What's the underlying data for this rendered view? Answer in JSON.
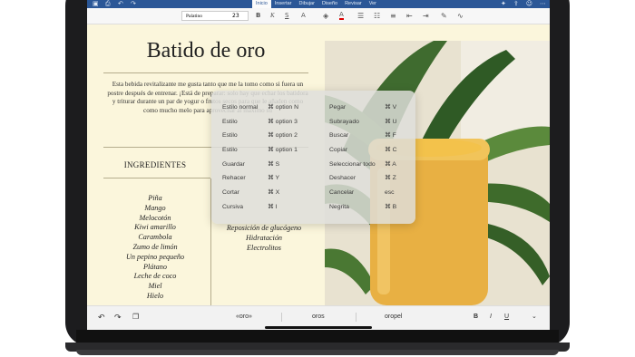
{
  "ribbon": {
    "tabs": [
      "Inicio",
      "Insertar",
      "Dibujar",
      "Diseño",
      "Revisar",
      "Ver"
    ],
    "active_tab": "Inicio",
    "colors": {
      "ribbon": "#2b5797",
      "page": "#fbf6dc"
    }
  },
  "toolbar": {
    "font_name": "Palatino",
    "font_size": "23"
  },
  "document": {
    "title": "Batido de oro",
    "intro": "Esta bebida revitalizante me gusta tanto que me la tomo como si fuera un postre después de entrenar. ¡Está de preparar: solo hay que echar los batidora y triturar durante un par de yogur o frutos secos para que le añaden como como mucho melo para aprovechar al máximo su",
    "ingredients_title": "INGREDIENTES",
    "ingredients": [
      "Piña",
      "Mango",
      "Melocotón",
      "Kiwi amarillo",
      "Carambola",
      "Zumo de limón",
      "Un pepino pequeño",
      "Plátano",
      "Leche de coco",
      "Miel",
      "Hielo"
    ],
    "ingredients_col2": [
      "Reposición de glucógeno",
      "Hidratación",
      "Electrolitos"
    ]
  },
  "shortcuts": {
    "left": [
      {
        "label": "Estilo normal",
        "keys": "⌘ option N"
      },
      {
        "label": "Estilo",
        "keys": "⌘ option 3"
      },
      {
        "label": "Estilo",
        "keys": "⌘ option 2"
      },
      {
        "label": "Estilo",
        "keys": "⌘ option 1"
      },
      {
        "label": "Guardar",
        "keys": "⌘ S"
      },
      {
        "label": "Rehacer",
        "keys": "⌘ Y"
      },
      {
        "label": "Cortar",
        "keys": "⌘ X"
      },
      {
        "label": "Cursiva",
        "keys": "⌘ I"
      }
    ],
    "right": [
      {
        "label": "Pegar",
        "keys": "⌘ V"
      },
      {
        "label": "Subrayado",
        "keys": "⌘ U"
      },
      {
        "label": "Buscar",
        "keys": "⌘ F"
      },
      {
        "label": "Copiar",
        "keys": "⌘ C"
      },
      {
        "label": "Seleccionar todo",
        "keys": "⌘ A"
      },
      {
        "label": "Deshacer",
        "keys": "⌘ Z"
      },
      {
        "label": "Cancelar",
        "keys": "esc"
      },
      {
        "label": "Negrita",
        "keys": "⌘ B"
      }
    ]
  },
  "bottom_bar": {
    "suggestions": [
      "«oro»",
      "oros",
      "oropel"
    ],
    "format_buttons": [
      "B",
      "I",
      "U"
    ]
  }
}
